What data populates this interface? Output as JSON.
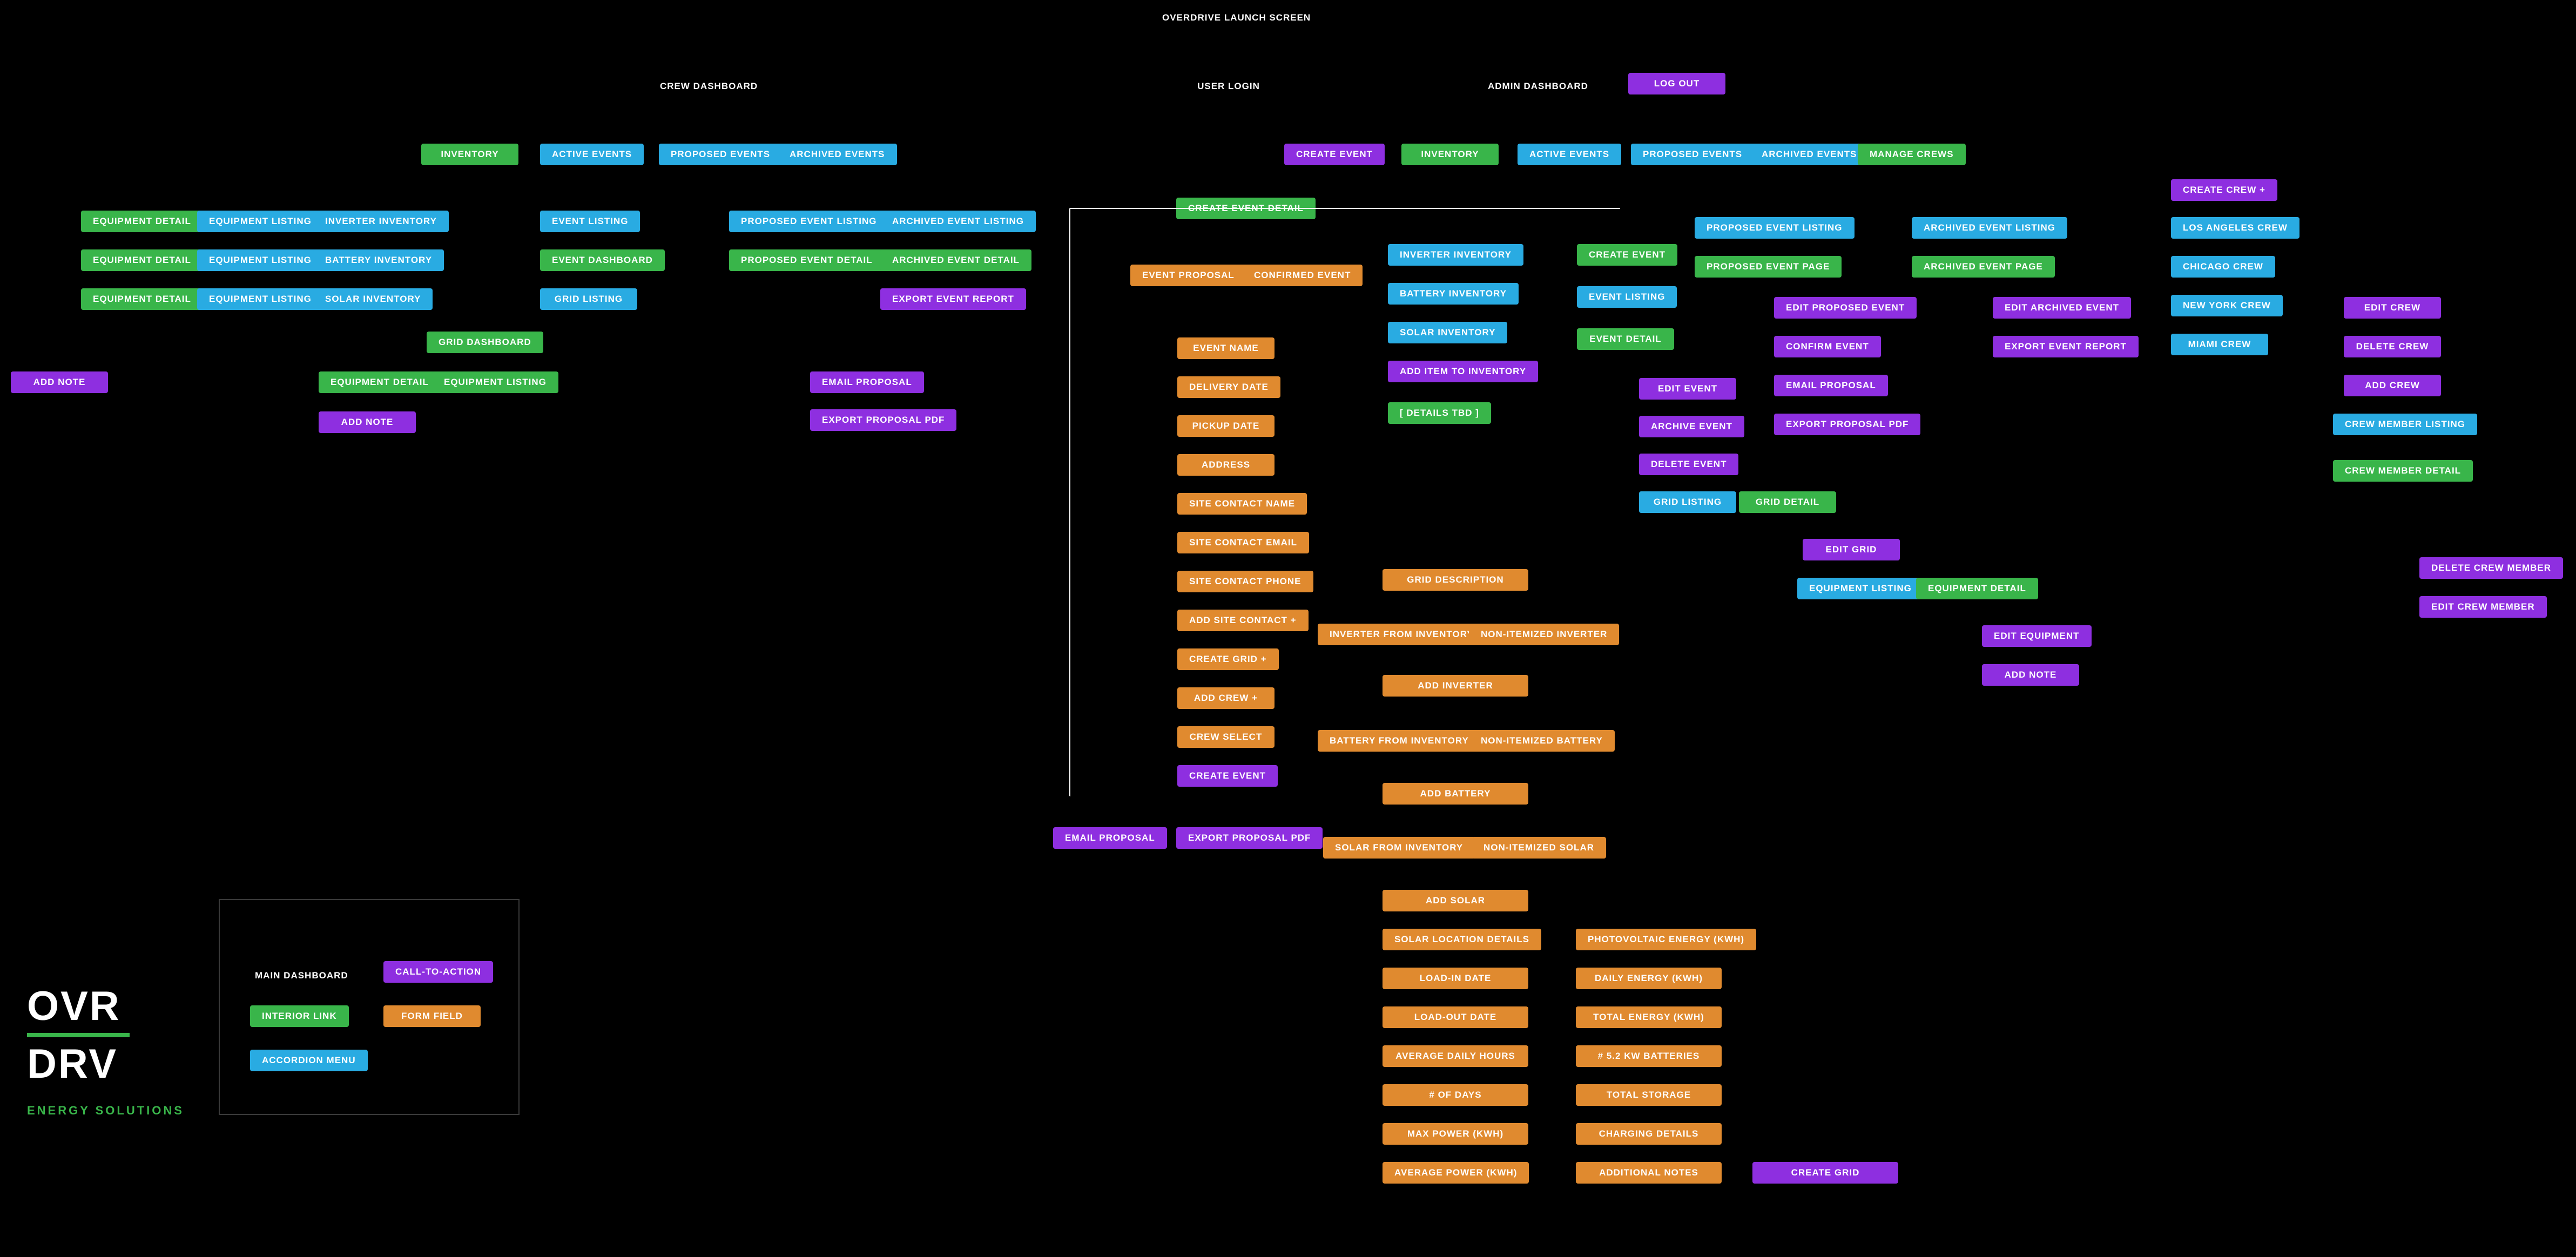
{
  "title": "OVERDRIVE LAUNCH SCREEN",
  "nodes": {
    "crewDash": "CREW DASHBOARD",
    "userLogin": "USER LOGIN",
    "adminDash": "ADMIN DASHBOARD",
    "logOut": "LOG OUT",
    "inventory1": "INVENTORY",
    "activeEvents1": "ACTIVE EVENTS",
    "proposedEvents1": "PROPOSED EVENTS",
    "archivedEvents1": "ARCHIVED EVENTS",
    "equipDetail1": "EQUIPMENT DETAIL",
    "equipDetail2": "EQUIPMENT DETAIL",
    "equipDetail3": "EQUIPMENT DETAIL",
    "equipListing1": "EQUIPMENT LISTING",
    "equipListing2": "EQUIPMENT LISTING",
    "equipListing3": "EQUIPMENT LISTING",
    "inverterInv1": "INVERTER INVENTORY",
    "batteryInv1": "BATTERY INVENTORY",
    "solarInv1": "SOLAR INVENTORY",
    "eventListing1": "EVENT LISTING",
    "eventDashboard": "EVENT DASHBOARD",
    "gridListing1": "GRID LISTING",
    "gridDashboard": "GRID DASHBOARD",
    "propEventListing1": "PROPOSED EVENT LISTING",
    "propEventDetail1": "PROPOSED EVENT DETAIL",
    "archEventListing1": "ARCHIVED EVENT LISTING",
    "archEventDetail1": "ARCHIVED EVENT DETAIL",
    "exportEventReport1": "EXPORT EVENT REPORT",
    "equipDetail4": "EQUIPMENT DETAIL",
    "equipListing4": "EQUIPMENT LISTING",
    "addNoteLeft": "ADD NOTE",
    "addNote1": "ADD NOTE",
    "emailProposal1": "EMAIL PROPOSAL",
    "exportProposalPdf1": "EXPORT PROPOSAL PDF",
    "createEventTop": "CREATE EVENT",
    "inventory2": "INVENTORY",
    "activeEvents2": "ACTIVE EVENTS",
    "proposedEvents2": "PROPOSED EVENTS",
    "archivedEvents2": "ARCHIVED EVENTS",
    "manageCrews": "MANAGE CREWS",
    "createEventDetail": "CREATE EVENT DETAIL",
    "eventProposal": "EVENT PROPOSAL",
    "confirmedEvent": "CONFIRMED EVENT",
    "eventName": "EVENT NAME",
    "deliveryDate": "DELIVERY DATE",
    "pickupDate": "PICKUP DATE",
    "address": "ADDRESS",
    "siteContactName": "SITE CONTACT NAME",
    "siteContactEmail": "SITE CONTACT EMAIL",
    "siteContactPhone": "SITE CONTACT PHONE",
    "addSiteContact": "ADD SITE CONTACT +",
    "createGridPlus": "CREATE GRID +",
    "addCrewPlus": "ADD CREW +",
    "crewSelect": "CREW SELECT",
    "createEventBtn": "CREATE EVENT",
    "emailProposal2": "EMAIL PROPOSAL",
    "exportProposalPdf2": "EXPORT PROPOSAL PDF",
    "inverterInv2": "INVERTER INVENTORY",
    "batteryInv2": "BATTERY INVENTORY",
    "solarInv2": "SOLAR INVENTORY",
    "addItemInv": "ADD ITEM TO INVENTORY",
    "detailsTbd": "[ DETAILS TBD ]",
    "createEvent2": "CREATE EVENT",
    "eventListing2": "EVENT LISTING",
    "eventDetail2": "EVENT DETAIL",
    "editEvent": "EDIT EVENT",
    "archiveEvent": "ARCHIVE EVENT",
    "deleteEvent": "DELETE EVENT",
    "gridListing2": "GRID LISTING",
    "gridDetail": "GRID DETAIL",
    "editGrid": "EDIT GRID",
    "equipListing5": "EQUIPMENT LISTING",
    "equipDetail5": "EQUIPMENT DETAIL",
    "editEquipment": "EDIT EQUIPMENT",
    "addNote2": "ADD NOTE",
    "propEventListing2": "PROPOSED EVENT LISTING",
    "propEventPage": "PROPOSED EVENT PAGE",
    "editProposedEvent": "EDIT PROPOSED EVENT",
    "confirmEvent": "CONFIRM EVENT",
    "emailProposal3": "EMAIL PROPOSAL",
    "exportProposalPdf3": "EXPORT PROPOSAL PDF",
    "archEventListing2": "ARCHIVED EVENT LISTING",
    "archEventPage": "ARCHIVED EVENT PAGE",
    "editArchivedEvent": "EDIT ARCHIVED EVENT",
    "exportEventReport2": "EXPORT EVENT REPORT",
    "createCrewPlus": "CREATE CREW +",
    "laCrew": "LOS ANGELES CREW",
    "chicagoCrew": "CHICAGO CREW",
    "nyCrew": "NEW YORK CREW",
    "miamiCrew": "MIAMI CREW",
    "editCrew": "EDIT CREW",
    "deleteCrew": "DELETE CREW",
    "addCrew": "ADD CREW",
    "crewMemberListing": "CREW MEMBER LISTING",
    "crewMemberDetail": "CREW MEMBER DETAIL",
    "deleteCrewMember": "DELETE CREW MEMBER",
    "editCrewMember": "EDIT CREW MEMBER",
    "gridDescription": "GRID DESCRIPTION",
    "inverterFromInv": "INVERTER FROM  INVENTORY",
    "nonItemInverter": "NON-ITEMIZED INVERTER",
    "addInverter": "ADD INVERTER",
    "batteryFromInv": "BATTERY FROM  INVENTORY",
    "nonItemBattery": "NON-ITEMIZED BATTERY",
    "addBattery": "ADD BATTERY",
    "solarFromInv": "SOLAR FROM  INVENTORY",
    "nonItemSolar": "NON-ITEMIZED SOLAR",
    "addSolar": "ADD SOLAR",
    "solarLocDetails": "SOLAR LOCATION DETAILS",
    "loadInDate": "LOAD-IN DATE",
    "loadOutDate": "LOAD-OUT DATE",
    "avgDailyHours": "AVERAGE DAILY HOURS",
    "numDays": "# OF DAYS",
    "maxPower": "MAX POWER (KWH)",
    "avgPower": "AVERAGE POWER (KWH)",
    "pvEnergy": "PHOTOVOLTAIC ENERGY (KWH)",
    "dailyEnergy": "DAILY ENERGY (KWH)",
    "totalEnergy": "TOTAL ENERGY (KWH)",
    "numBatteries": "# 5.2 KW BATTERIES",
    "totalStorage": "TOTAL STORAGE",
    "chargingDetails": "CHARGING DETAILS",
    "additionalNotes": "ADDITIONAL NOTES",
    "createGrid": "CREATE GRID"
  },
  "legend": {
    "mainDashboard": "MAIN DASHBOARD",
    "cta": "CALL-TO-ACTION",
    "interiorLink": "INTERIOR LINK",
    "formField": "FORM FIELD",
    "accordionMenu": "ACCORDION MENU"
  },
  "logo": {
    "line1": "OVR",
    "line2": "DRV",
    "sub": "ENERGY SOLUTIONS"
  }
}
